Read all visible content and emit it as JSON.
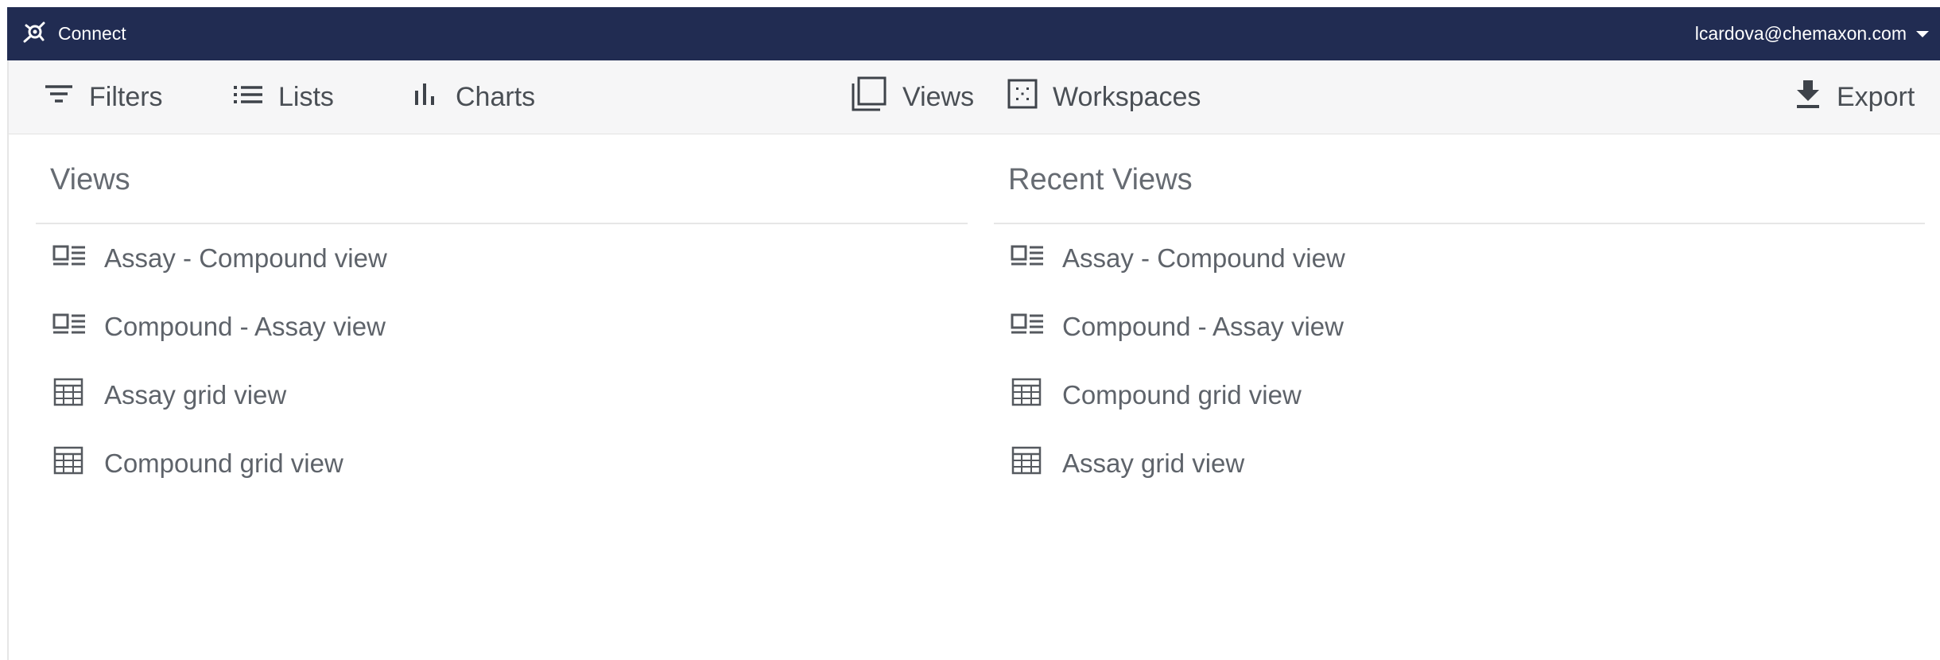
{
  "app": {
    "title": "Connect"
  },
  "user": {
    "email": "lcardova@chemaxon.com"
  },
  "toolbar": {
    "filters": "Filters",
    "lists": "Lists",
    "charts": "Charts",
    "views": "Views",
    "workspaces": "Workspaces",
    "export": "Export"
  },
  "views_panel": {
    "title": "Views",
    "items": [
      {
        "label": "Assay - Compound view",
        "icon": "detail-view-icon"
      },
      {
        "label": "Compound - Assay view",
        "icon": "detail-view-icon"
      },
      {
        "label": "Assay grid view",
        "icon": "grid-view-icon"
      },
      {
        "label": "Compound grid view",
        "icon": "grid-view-icon"
      }
    ]
  },
  "recent_panel": {
    "title": "Recent Views",
    "items": [
      {
        "label": "Assay - Compound view",
        "icon": "detail-view-icon"
      },
      {
        "label": "Compound - Assay view",
        "icon": "detail-view-icon"
      },
      {
        "label": "Compound grid view",
        "icon": "grid-view-icon"
      },
      {
        "label": "Assay grid view",
        "icon": "grid-view-icon"
      }
    ]
  },
  "colors": {
    "topbar": "#212c52",
    "toolbar": "#f6f6f7",
    "text": "#555a61"
  }
}
